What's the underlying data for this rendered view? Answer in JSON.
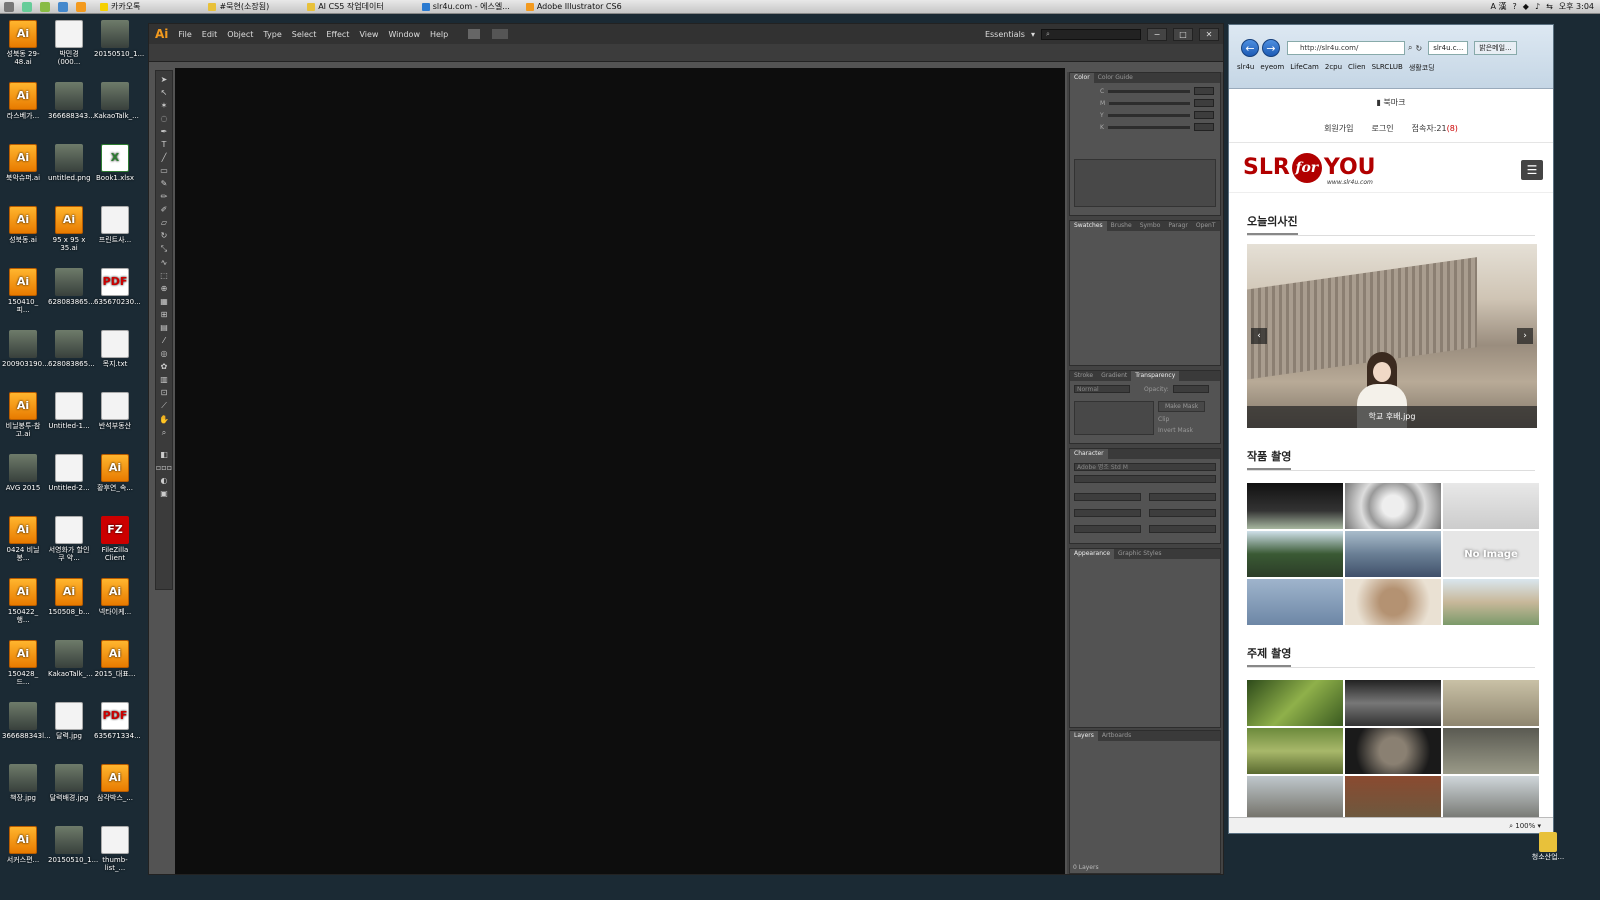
{
  "taskbar": {
    "items": [
      "카카오톡",
      "#묵현(소장됨)",
      "AI CS5 작업데이터",
      "slr4u.com - 에스엘...",
      "Adobe Illustrator CS6"
    ],
    "tray_lang": "A 漢",
    "clock": "오후 3:04"
  },
  "desktop": {
    "icons": [
      {
        "label": "성북동 29-48.ai",
        "kind": "ai"
      },
      {
        "label": "박민경(000...",
        "kind": "doc"
      },
      {
        "label": "20150510_1...",
        "kind": "img"
      },
      {
        "label": "라스베가...",
        "kind": "ai"
      },
      {
        "label": "366688343...",
        "kind": "img"
      },
      {
        "label": "KakaoTalk_...",
        "kind": "img"
      },
      {
        "label": "북악슈퍼.ai",
        "kind": "ai"
      },
      {
        "label": "untitled.png",
        "kind": "img"
      },
      {
        "label": "Book1.xlsx",
        "kind": "xl"
      },
      {
        "label": "성북동.ai",
        "kind": "ai"
      },
      {
        "label": "95 x 95 x 35.ai",
        "kind": "ai"
      },
      {
        "label": "프린트사...",
        "kind": "doc"
      },
      {
        "label": "150410_피...",
        "kind": "ai"
      },
      {
        "label": "628083865...",
        "kind": "img"
      },
      {
        "label": "635670230...",
        "kind": "pdf"
      },
      {
        "label": "200903190...",
        "kind": "img"
      },
      {
        "label": "628083865...",
        "kind": "img"
      },
      {
        "label": "목지.txt",
        "kind": "doc"
      },
      {
        "label": "비닐봉투-참고.ai",
        "kind": "ai"
      },
      {
        "label": "Untitled-1...",
        "kind": "doc"
      },
      {
        "label": "반석부동산",
        "kind": "doc"
      },
      {
        "label": "AVG 2015",
        "kind": "img"
      },
      {
        "label": "Untitled-2...",
        "kind": "doc"
      },
      {
        "label": "황후연_속...",
        "kind": "ai"
      },
      {
        "label": "0424 비닐봉...",
        "kind": "ai"
      },
      {
        "label": "서영화가 할인쿠 약...",
        "kind": "doc"
      },
      {
        "label": "FileZilla Client",
        "kind": "fz"
      },
      {
        "label": "150422_행...",
        "kind": "ai"
      },
      {
        "label": "150508_b...",
        "kind": "ai"
      },
      {
        "label": "넥타이케...",
        "kind": "ai"
      },
      {
        "label": "150428_드...",
        "kind": "ai"
      },
      {
        "label": "KakaoTalk_...",
        "kind": "img"
      },
      {
        "label": "2015_대표...",
        "kind": "ai"
      },
      {
        "label": "366688343l...",
        "kind": "img"
      },
      {
        "label": "달력.jpg",
        "kind": "doc"
      },
      {
        "label": "635671334...",
        "kind": "pdf"
      },
      {
        "label": "책장.jpg",
        "kind": "img"
      },
      {
        "label": "달력배경.jpg",
        "kind": "img"
      },
      {
        "label": "삼각박스_...",
        "kind": "ai"
      },
      {
        "label": "서커스편...",
        "kind": "ai"
      },
      {
        "label": "20150510_1...",
        "kind": "img"
      },
      {
        "label": "thumb-list_...",
        "kind": "doc"
      }
    ],
    "trash_label": "청소산업..."
  },
  "illustrator": {
    "logo": "Ai",
    "menus": [
      "File",
      "Edit",
      "Object",
      "Type",
      "Select",
      "Effect",
      "View",
      "Window",
      "Help"
    ],
    "workspace": "Essentials",
    "win_min": "−",
    "win_max": "□",
    "win_close": "✕",
    "panels": {
      "color_tabs": [
        "Color",
        "Color Guide"
      ],
      "color_channels": [
        "C",
        "M",
        "Y",
        "K"
      ],
      "swatch_tabs": [
        "Swatches",
        "Brushe",
        "Symbo",
        "Paragr",
        "OpenT"
      ],
      "stroke_tabs": [
        "Stroke",
        "Gradient",
        "Transparency"
      ],
      "blend_mode": "Normal",
      "opacity_label": "Opacity:",
      "make_mask": "Make Mask",
      "clip": "Clip",
      "invert_mask": "Invert Mask",
      "character_tab": "Character",
      "font_name": "Adobe 명조 Std M",
      "appearance_tabs": [
        "Appearance",
        "Graphic Styles"
      ],
      "layers_tabs": [
        "Layers",
        "Artboards"
      ],
      "layers_count": "0 Layers"
    }
  },
  "browser": {
    "address": "http://slr4u.com/",
    "tabs": [
      "slr4u.c...",
      "밝은메일..."
    ],
    "favorites": [
      "slr4u",
      "eyeom",
      "LifeCam",
      "2cpu",
      "Clien",
      "SLRCLUB",
      "생활코딩"
    ],
    "zoom": "100%",
    "site": {
      "bookmark": "북마크",
      "signup": "회원가입",
      "login": "로그인",
      "visitors_label": "접속자:21",
      "visitors_badge": "(8)",
      "logo_left": "SLR",
      "logo_mid": "for",
      "logo_right": "YOU",
      "logo_url": "www.slr4u.com",
      "today_photo": "오늘의사진",
      "photo_caption": "학교 후배.jpg",
      "works": "작품 촬영",
      "theme": "주제 촬영",
      "no_image": "No Image"
    }
  }
}
